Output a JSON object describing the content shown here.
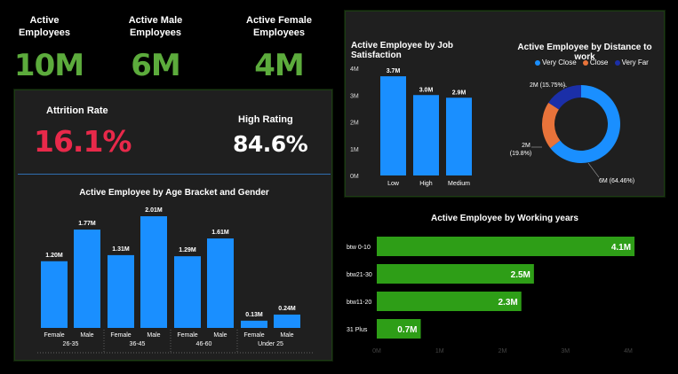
{
  "kpis": {
    "active": {
      "label_line1": "Active",
      "label_line2": "Employees",
      "value": "10M"
    },
    "male": {
      "label_line1": "Active Male",
      "label_line2": "Employees",
      "value": "6M"
    },
    "female": {
      "label_line1": "Active Female",
      "label_line2": "Employees",
      "value": "4M"
    },
    "attrition": {
      "label": "Attrition Rate",
      "value": "16.1%"
    },
    "high_rating": {
      "label": "High Rating",
      "value": "84.6%"
    }
  },
  "colors": {
    "kpi_green": "#5cab3c",
    "attrition_red": "#e8294a",
    "bar_blue": "#1a8fff",
    "bar_green": "#2e9e17",
    "donut_blue": "#1a8fff",
    "donut_orange": "#e8733a",
    "donut_navy": "#1b2fa8"
  },
  "chart_data": [
    {
      "type": "bar",
      "title": "Active Employee by Job Satisfaction",
      "categories": [
        "Low",
        "High",
        "Medium"
      ],
      "values": [
        3.7,
        3.0,
        2.9
      ],
      "value_labels": [
        "3.7M",
        "3.0M",
        "2.9M"
      ],
      "y_ticks": [
        "0M",
        "1M",
        "2M",
        "3M",
        "4M"
      ],
      "ylim": [
        0,
        4
      ]
    },
    {
      "type": "pie",
      "title": "Active Employee by Distance to work",
      "legend": [
        "Very Close",
        "Close",
        "Very Far"
      ],
      "values": [
        64.46,
        19.8,
        15.75
      ],
      "slice_labels": [
        "6M (64.46%)",
        "2M",
        "(19.8%)",
        "2M (15.75%)"
      ]
    },
    {
      "type": "bar",
      "title": "Active Employee by Age Bracket and Gender",
      "groups": [
        "26-35",
        "36-45",
        "46-60",
        "Under 25"
      ],
      "categories": [
        "Female",
        "Male",
        "Female",
        "Male",
        "Female",
        "Male",
        "Female",
        "Male"
      ],
      "values": [
        1.2,
        1.77,
        1.31,
        2.01,
        1.29,
        1.61,
        0.13,
        0.24
      ],
      "value_labels": [
        "1.20M",
        "1.77M",
        "1.31M",
        "2.01M",
        "1.29M",
        "1.61M",
        "0.13M",
        "0.24M"
      ]
    },
    {
      "type": "bar",
      "orientation": "horizontal",
      "title": "Active Employee by Working years",
      "categories": [
        "btw 0-10",
        "btw21-30",
        "btw11-20",
        "31 Plus"
      ],
      "values": [
        4.1,
        2.5,
        2.3,
        0.7
      ],
      "value_labels": [
        "4.1M",
        "2.5M",
        "2.3M",
        "0.7M"
      ],
      "x_ticks": [
        "0M",
        "1M",
        "2M",
        "3M",
        "4M"
      ],
      "xlim": [
        0,
        4
      ]
    }
  ]
}
